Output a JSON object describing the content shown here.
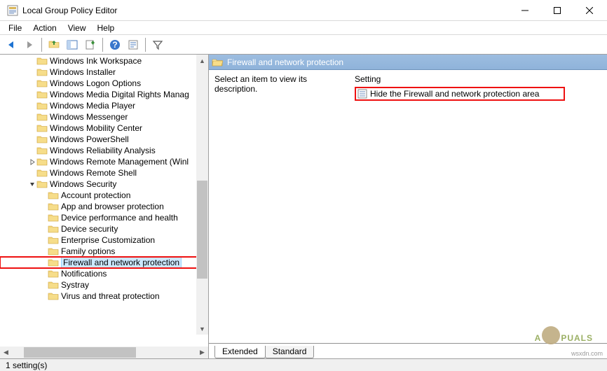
{
  "window": {
    "title": "Local Group Policy Editor"
  },
  "menu": {
    "file": "File",
    "action": "Action",
    "view": "View",
    "help": "Help"
  },
  "tree": {
    "items": [
      {
        "indent": 3,
        "exp": "",
        "label": "Windows Ink Workspace"
      },
      {
        "indent": 3,
        "exp": "",
        "label": "Windows Installer"
      },
      {
        "indent": 3,
        "exp": "",
        "label": "Windows Logon Options"
      },
      {
        "indent": 3,
        "exp": "",
        "label": "Windows Media Digital Rights Manag"
      },
      {
        "indent": 3,
        "exp": "",
        "label": "Windows Media Player"
      },
      {
        "indent": 3,
        "exp": "",
        "label": "Windows Messenger"
      },
      {
        "indent": 3,
        "exp": "",
        "label": "Windows Mobility Center"
      },
      {
        "indent": 3,
        "exp": "",
        "label": "Windows PowerShell"
      },
      {
        "indent": 3,
        "exp": "",
        "label": "Windows Reliability Analysis"
      },
      {
        "indent": 3,
        "exp": ">",
        "label": "Windows Remote Management (Winl"
      },
      {
        "indent": 3,
        "exp": "",
        "label": "Windows Remote Shell"
      },
      {
        "indent": 3,
        "exp": "v",
        "label": "Windows Security"
      },
      {
        "indent": 4,
        "exp": "",
        "label": "Account protection"
      },
      {
        "indent": 4,
        "exp": "",
        "label": "App and browser protection"
      },
      {
        "indent": 4,
        "exp": "",
        "label": "Device performance and health"
      },
      {
        "indent": 4,
        "exp": "",
        "label": "Device security"
      },
      {
        "indent": 4,
        "exp": "",
        "label": "Enterprise Customization"
      },
      {
        "indent": 4,
        "exp": "",
        "label": "Family options"
      },
      {
        "indent": 4,
        "exp": "",
        "label": "Firewall and network protection",
        "selected": true,
        "highlight": true
      },
      {
        "indent": 4,
        "exp": "",
        "label": "Notifications"
      },
      {
        "indent": 4,
        "exp": "",
        "label": "Systray"
      },
      {
        "indent": 4,
        "exp": "",
        "label": "Virus and threat protection"
      }
    ]
  },
  "detail": {
    "header": "Firewall and network protection",
    "description_prompt": "Select an item to view its description.",
    "column_header": "Setting",
    "setting_label": "Hide the Firewall and network protection area"
  },
  "tabs": {
    "extended": "Extended",
    "standard": "Standard"
  },
  "status": {
    "text": "1 setting(s)"
  },
  "watermark": "wsxdn.com",
  "logo_text_a": "A",
  "logo_text_b": "PUALS"
}
